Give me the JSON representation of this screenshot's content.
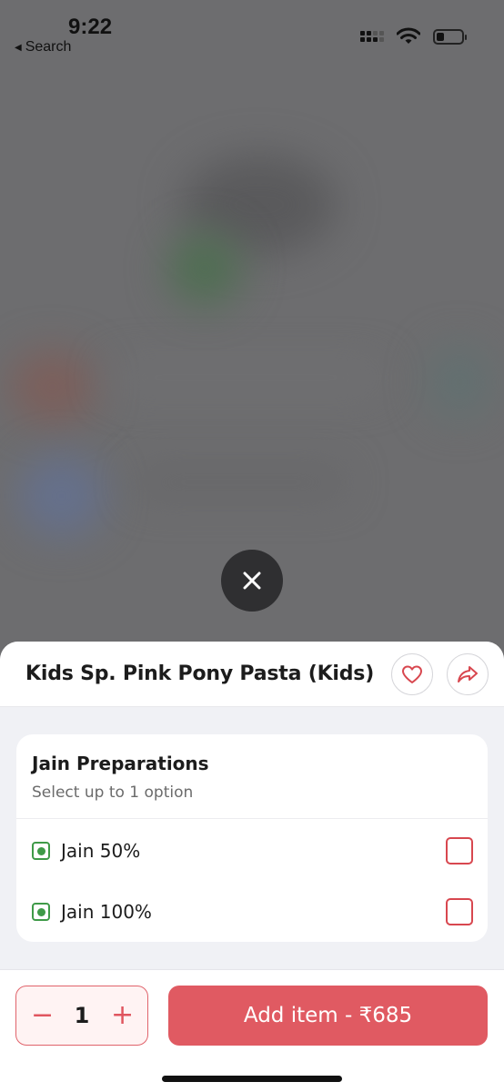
{
  "status_bar": {
    "time": "9:22",
    "back_label": "Search",
    "back_icon": "back-triangle-icon",
    "battery_level": 0.3
  },
  "close_icon": "close-icon",
  "item": {
    "title": "Kids Sp. Pink Pony Pasta (Kids)",
    "favorite_icon": "heart-icon",
    "share_icon": "share-icon"
  },
  "option_group": {
    "title": "Jain Preparations",
    "subtitle": "Select up to 1 option",
    "options": [
      {
        "label": "Jain 50%",
        "veg": true,
        "checked": false
      },
      {
        "label": "Jain 100%",
        "veg": true,
        "checked": false
      }
    ]
  },
  "cart": {
    "minus": "−",
    "quantity": "1",
    "plus": "+",
    "add_label": "Add item - ₹685"
  },
  "colors": {
    "accent": "#e05a62",
    "veg": "#3f9a48",
    "stepper_bg": "#fff3f3"
  }
}
